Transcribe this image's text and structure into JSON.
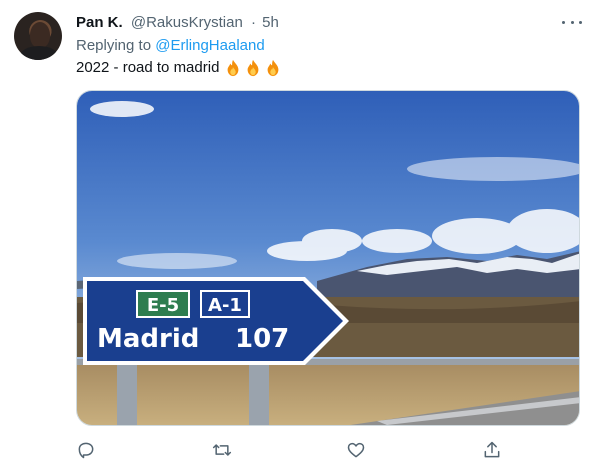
{
  "tweet": {
    "display_name": "Pan K.",
    "handle": "@RakusKrystian",
    "separator": "·",
    "time": "5h",
    "replying_prefix": "Replying to",
    "replying_to": "@ErlingHaaland",
    "text": "2022 - road to madrid",
    "emoji": [
      "fire",
      "fire",
      "fire"
    ]
  },
  "image": {
    "sign_route_e": "E-5",
    "sign_route_a": "A-1",
    "sign_city": "Madrid",
    "sign_distance": "107"
  },
  "actions": [
    "reply-icon",
    "retweet-icon",
    "like-icon",
    "share-icon"
  ],
  "colors": {
    "link": "#1d9bf0",
    "secondary": "#536471",
    "sign_blue": "#1a3f8f",
    "sign_green": "#2e7d4f"
  }
}
